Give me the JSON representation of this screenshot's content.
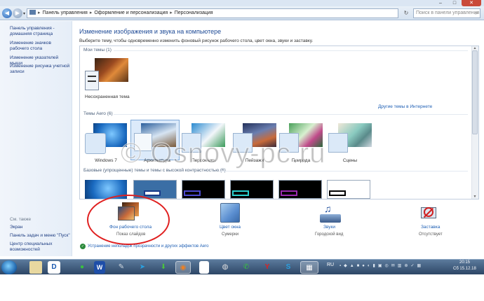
{
  "window": {
    "controls": {
      "minimize": "–",
      "maximize": "□",
      "close": "✕"
    }
  },
  "navbar": {
    "back_icon": "◀",
    "forward_icon": "▶",
    "dropdown_icon": "▾",
    "breadcrumb": [
      "Панель управления",
      "Оформление и персонализация",
      "Персонализация"
    ],
    "breadcrumb_separator": "▸",
    "refresh_icon": "↻",
    "search_placeholder": "Поиск в панели управления",
    "search_icon": "⌕"
  },
  "sidebar": {
    "links": [
      "Панель управления - домашняя страница",
      "Изменение значков рабочего стола",
      "Изменение указателей мыши",
      "Изменение рисунка учетной записи"
    ],
    "see_also_caption": "См. также",
    "see_also": [
      "Экран",
      "Панель задач и меню \"Пуск\"",
      "Центр специальных возможностей"
    ]
  },
  "main": {
    "title": "Изменение изображения и звука на компьютере",
    "description": "Выберите тему, чтобы одновременно изменить фоновый рисунок рабочего стола, цвет окна, звуки и заставку.",
    "my_themes_label": "Мои темы (1)",
    "my_theme_name": "Несохраненная тема",
    "online_link": "Другие темы в Интернете",
    "aero_label": "Темы Aero (6)",
    "aero_themes": [
      "Windows 7",
      "Архитектура",
      "Персонажи",
      "Пейзажи",
      "Природа",
      "Сцены"
    ],
    "basic_label": "Базовые (упрощенные) темы и темы с высокой контрастностью (6)",
    "bottom": [
      {
        "title": "Фон рабочего стола",
        "sub": "Показ слайдов",
        "icon": "desktop-background-icon"
      },
      {
        "title": "Цвет окна",
        "sub": "Сумерки",
        "icon": "window-color-icon"
      },
      {
        "title": "Звуки",
        "sub": "Городской вид",
        "icon": "sounds-icon"
      },
      {
        "title": "Заставка",
        "sub": "Отсутствует",
        "icon": "screensaver-icon"
      }
    ],
    "trouble_link": "Устранение неполадок прозрачности и других эффектов Aero"
  },
  "watermark": "© Osnovy-pc.ru",
  "taskbar": {
    "language": "RU",
    "time": "20:15",
    "date": "Сб 15.12.18"
  },
  "colors": {
    "accent_link": "#1e5fb4",
    "highlight_ellipse": "#e02020",
    "taskbar": "#2d4666"
  }
}
